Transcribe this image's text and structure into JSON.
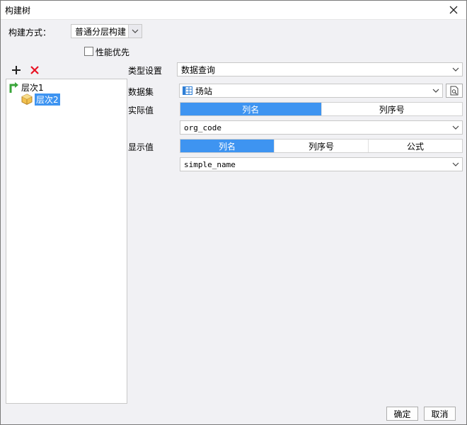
{
  "window": {
    "title": "构建树"
  },
  "build": {
    "label": "构建方式：",
    "value": "普通分层构建"
  },
  "performance": {
    "label": "性能优先",
    "checked": false
  },
  "tree": {
    "items": [
      {
        "label": "层次1",
        "selected": false
      },
      {
        "label": "层次2",
        "selected": true
      }
    ]
  },
  "type_setting": {
    "label": "类型设置",
    "value": "数据查询"
  },
  "dataset": {
    "label": "数据集",
    "value": "场站"
  },
  "actual_value": {
    "label": "实际值",
    "tabs": [
      "列名",
      "列序号"
    ],
    "active": 0,
    "field": "org_code"
  },
  "display_value": {
    "label": "显示值",
    "tabs": [
      "列名",
      "列序号",
      "公式"
    ],
    "active": 0,
    "field": "simple_name"
  },
  "buttons": {
    "ok": "确定",
    "cancel": "取消"
  },
  "colors": {
    "accent": "#3e94f1",
    "delete": "#e81123",
    "tree_arrow": "#3aa53a"
  }
}
